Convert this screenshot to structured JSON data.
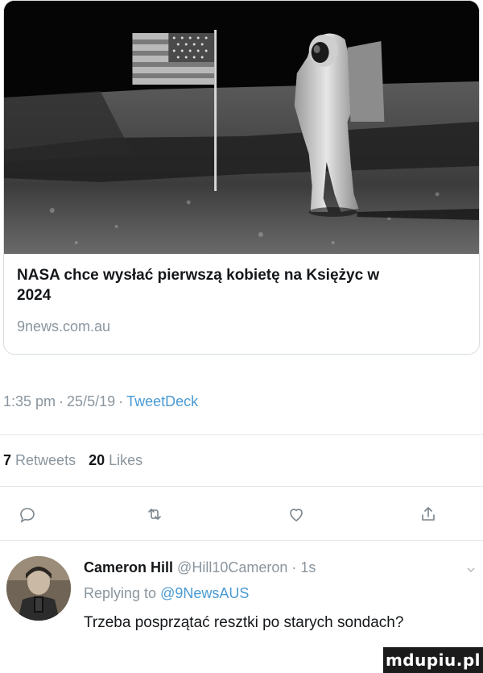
{
  "card": {
    "title": "NASA chce wysłać pierwszą kobietę na Księżyc w 2024",
    "domain": "9news.com.au",
    "image_description_icon": "moon-landing-photo"
  },
  "meta": {
    "time": "1:35 pm",
    "date": "25/5/19",
    "client": "TweetDeck",
    "separator": "·"
  },
  "stats": {
    "retweets_count": "7",
    "retweets_label": "Retweets",
    "likes_count": "20",
    "likes_label": "Likes"
  },
  "actions": [
    {
      "name": "reply",
      "icon": "comment-icon"
    },
    {
      "name": "retweet",
      "icon": "retweet-icon"
    },
    {
      "name": "like",
      "icon": "heart-icon"
    },
    {
      "name": "share",
      "icon": "share-icon"
    }
  ],
  "reply": {
    "name": "Cameron Hill",
    "handle": "@Hill10Cameron",
    "separator": "·",
    "age": "1s",
    "replying_prefix": "Replying to",
    "replying_to": "@9NewsAUS",
    "text": "Trzeba posprzątać resztki po starych sondach?"
  },
  "watermark": "mdupiu.pl",
  "colors": {
    "link": "#4a9ad4",
    "muted": "#8a959e",
    "text": "#14171a"
  }
}
